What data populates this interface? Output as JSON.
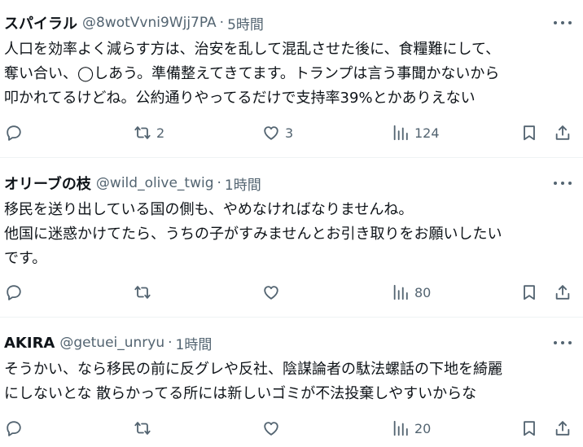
{
  "tweets": [
    {
      "name": "スパイラル",
      "handle": "@8wotVvni9Wjj7PA",
      "sep": "·",
      "time": "5時間",
      "lines": [
        "人口を効率よく減らす方は、治安を乱して混乱させた後に、食糧難にして、",
        "奪い合い、◯しあう。準備整えてきてます。トランプは言う事聞かないから",
        "叩かれてるけどね。公約通りやってるだけで支持率39%とかありえない"
      ],
      "reposts": "2",
      "likes": "3",
      "views": "124"
    },
    {
      "name": "オリーブの枝",
      "handle": "@wild_olive_twig",
      "sep": "·",
      "time": "1時間",
      "lines": [
        "移民を送り出している国の側も、やめなければなりませんね。",
        "他国に迷惑かけてたら、うちの子がすみませんとお引き取りをお願いしたい",
        "です。"
      ],
      "reposts": "",
      "likes": "",
      "views": "80"
    },
    {
      "name": "AKIRA",
      "handle": "@getuei_unryu",
      "sep": "·",
      "time": "1時間",
      "lines": [
        "そうかい、なら移民の前に反グレや反社、陰謀論者の駄法螺話の下地を綺麗",
        "にしないとな  散らかってる所には新しいゴミが不法投棄しやすいからな"
      ],
      "reposts": "",
      "likes": "",
      "views": "20"
    }
  ],
  "icons": {
    "reply": "reply-icon",
    "repost": "repost-icon",
    "like": "heart-icon",
    "views": "views-icon",
    "bookmark": "bookmark-icon",
    "share": "share-icon",
    "more": "more-icon"
  },
  "colors": {
    "text": "#0f1419",
    "secondary": "#536471",
    "divider": "#eff3f4"
  }
}
